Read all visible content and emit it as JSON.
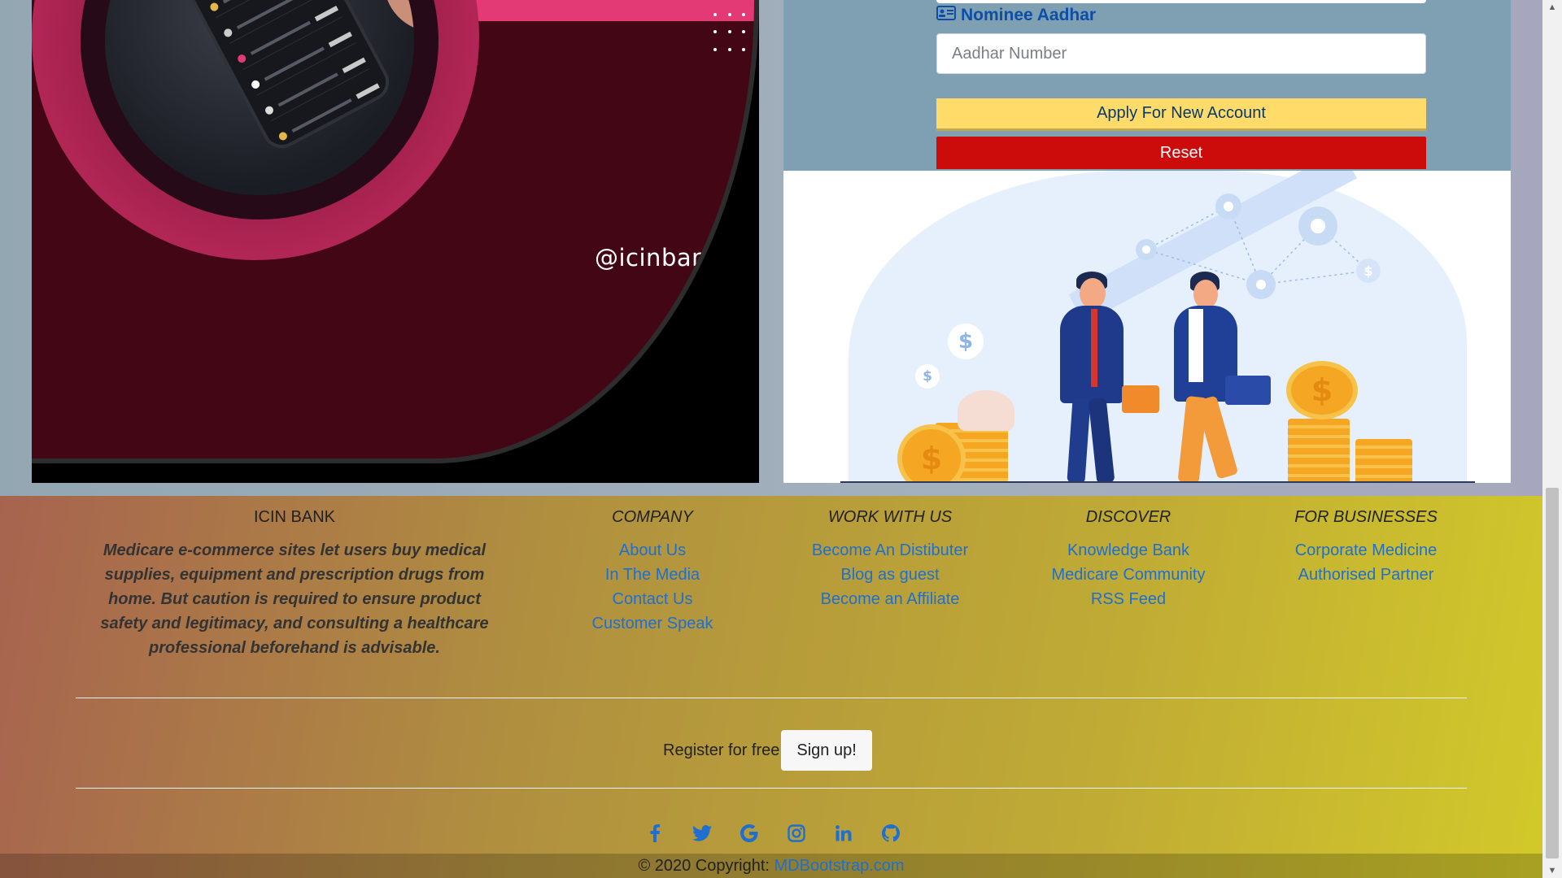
{
  "promo": {
    "handle": "@icinbank"
  },
  "form": {
    "nominee_label": "Nominee Aadhar",
    "aadhar_placeholder": "Aadhar Number",
    "apply_label": "Apply For New Account",
    "reset_label": "Reset"
  },
  "footer": {
    "brand": {
      "title": "ICIN BANK",
      "text": "Medicare e-commerce sites let users buy medical supplies, equipment and prescription drugs from home. But caution is required to ensure product safety and legitimacy, and consulting a healthcare professional beforehand is advisable."
    },
    "columns": [
      {
        "title": "COMPANY",
        "links": [
          "About Us",
          "In The Media",
          "Contact Us",
          "Customer Speak"
        ]
      },
      {
        "title": "WORK WITH US",
        "links": [
          "Become An Distibuter",
          "Blog as guest",
          "Become an Affiliate"
        ]
      },
      {
        "title": "DISCOVER",
        "links": [
          "Knowledge Bank",
          "Medicare Community",
          "RSS Feed"
        ]
      },
      {
        "title": "FOR BUSINESSES",
        "links": [
          "Corporate Medicine",
          "Authorised Partner"
        ]
      }
    ],
    "register_text": "Register for free",
    "signup_label": "Sign up!",
    "socials": [
      "facebook-icon",
      "twitter-icon",
      "google-icon",
      "instagram-icon",
      "linkedin-icon",
      "github-icon"
    ],
    "copyright_text": "© 2020 Copyright:",
    "copyright_link": "MDBootstrap.com"
  },
  "colors": {
    "link": "#1e6fd0",
    "apply": "#ffdc6a",
    "reset": "#cc0b0b",
    "promo_bg": "#420614",
    "nominee_label": "#0d4ea6"
  }
}
